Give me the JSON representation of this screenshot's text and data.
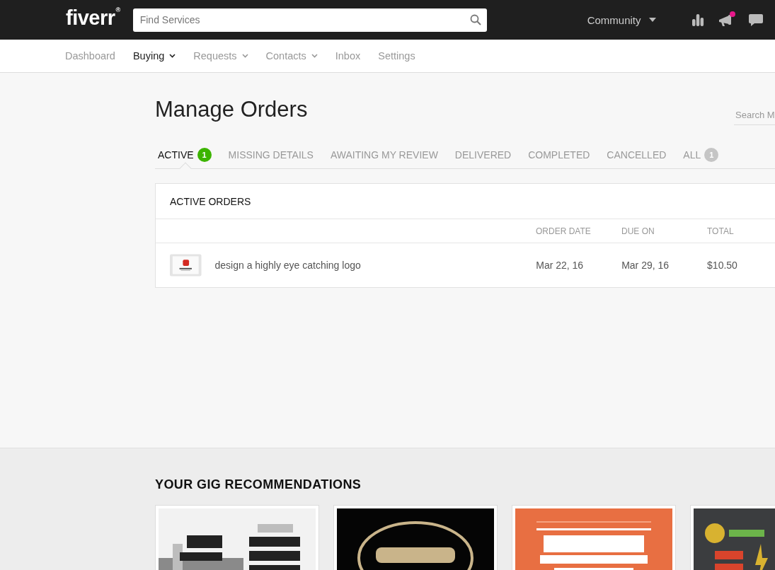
{
  "header": {
    "logo": "fiverr",
    "logo_mark": "®",
    "search": {
      "placeholder": "Find Services"
    },
    "community": "Community",
    "notification_dot": true
  },
  "nav": [
    {
      "label": "Dashboard",
      "selected": false,
      "dropdown": false
    },
    {
      "label": "Buying",
      "selected": true,
      "dropdown": true
    },
    {
      "label": "Requests",
      "selected": false,
      "dropdown": true
    },
    {
      "label": "Contacts",
      "selected": false,
      "dropdown": true
    },
    {
      "label": "Inbox",
      "selected": false,
      "dropdown": false
    },
    {
      "label": "Settings",
      "selected": false,
      "dropdown": false
    }
  ],
  "page_title": "Manage Orders",
  "order_search": {
    "placeholder": "Search M"
  },
  "tabs": [
    {
      "label": "ACTIVE",
      "selected": true,
      "count": "1",
      "color": "#3cb400"
    },
    {
      "label": "MISSING DETAILS",
      "selected": false
    },
    {
      "label": "AWAITING MY REVIEW",
      "selected": false
    },
    {
      "label": "DELIVERED",
      "selected": false
    },
    {
      "label": "COMPLETED",
      "selected": false
    },
    {
      "label": "CANCELLED",
      "selected": false
    },
    {
      "label": "ALL",
      "selected": false,
      "count": "1",
      "color": "#c5c5c5"
    }
  ],
  "table": {
    "title": "ACTIVE ORDERS",
    "columns": [
      "ORDER DATE",
      "DUE ON",
      "TOTAL"
    ],
    "rows": [
      {
        "thumbnail": {
          "kind": "picture"
        },
        "gig": "design a highly eye catching logo",
        "cells": [
          "Mar 22, 16",
          "Mar 29, 16",
          "$10.50"
        ]
      }
    ]
  },
  "recommendations": {
    "title": "YOUR GIG RECOMMENDATIONS",
    "gigs": [
      {
        "kind": "picture"
      },
      {
        "kind": "picture"
      },
      {
        "kind": "picture"
      },
      {
        "kind": "picture"
      }
    ]
  }
}
